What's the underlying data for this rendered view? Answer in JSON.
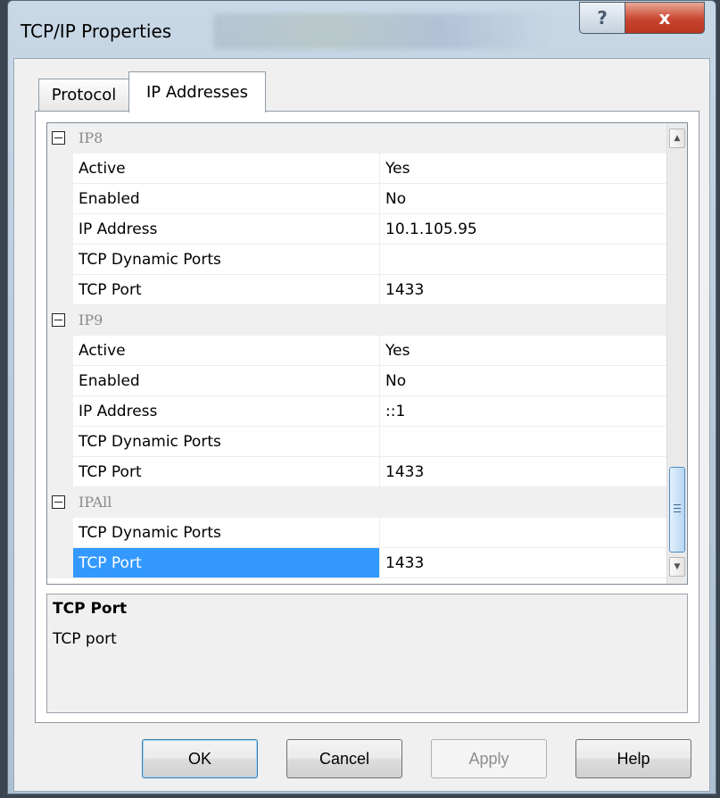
{
  "window": {
    "title": "TCP/IP Properties",
    "help_glyph": "?",
    "close_glyph": "x"
  },
  "tabs": [
    {
      "label": "Protocol"
    },
    {
      "label": "IP Addresses"
    }
  ],
  "grid": {
    "rows": [
      {
        "kind": "category",
        "label": "IP8"
      },
      {
        "kind": "property",
        "name": "Active",
        "value": "Yes"
      },
      {
        "kind": "property",
        "name": "Enabled",
        "value": "No"
      },
      {
        "kind": "property",
        "name": "IP Address",
        "value": "10.1.105.95"
      },
      {
        "kind": "property",
        "name": "TCP Dynamic Ports",
        "value": ""
      },
      {
        "kind": "property",
        "name": "TCP Port",
        "value": "1433"
      },
      {
        "kind": "category",
        "label": "IP9"
      },
      {
        "kind": "property",
        "name": "Active",
        "value": "Yes"
      },
      {
        "kind": "property",
        "name": "Enabled",
        "value": "No"
      },
      {
        "kind": "property",
        "name": "IP Address",
        "value": "::1"
      },
      {
        "kind": "property",
        "name": "TCP Dynamic Ports",
        "value": ""
      },
      {
        "kind": "property",
        "name": "TCP Port",
        "value": "1433"
      },
      {
        "kind": "category",
        "label": "IPAll"
      },
      {
        "kind": "property",
        "name": "TCP Dynamic Ports",
        "value": ""
      },
      {
        "kind": "property",
        "name": "TCP Port",
        "value": "1433",
        "selected": true
      }
    ],
    "scroll_fraction": 1.0
  },
  "description": {
    "title": "TCP Port",
    "text": "TCP port"
  },
  "buttons": {
    "ok": "OK",
    "cancel": "Cancel",
    "apply": "Apply",
    "help": "Help"
  },
  "colors": {
    "selection": "#3399ff",
    "close_button": "#c9452f"
  }
}
